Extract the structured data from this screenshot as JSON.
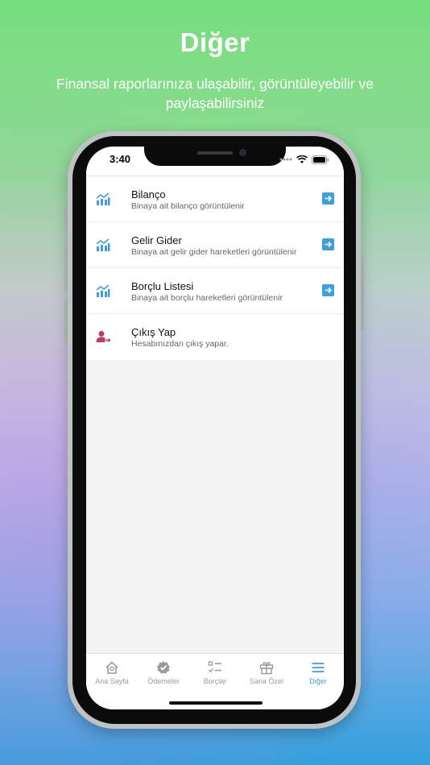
{
  "hero": {
    "title": "Diğer",
    "subtitle": "Finansal raporlarınıza ulaşabilir, görüntüleyebilir ve paylaşabilirsiniz"
  },
  "status_bar": {
    "time": "3:40"
  },
  "menu": {
    "items": [
      {
        "title": "Bilanço",
        "subtitle": "Binaya ait bilanço görüntülenir",
        "icon": "chart-icon"
      },
      {
        "title": "Gelir Gider",
        "subtitle": "Binaya ait gelir gider hareketleri görüntülenir",
        "icon": "chart-icon"
      },
      {
        "title": "Borçlu Listesi",
        "subtitle": "Binaya ait borçlu hareketleri görüntülenir",
        "icon": "chart-icon"
      },
      {
        "title": "Çıkış Yap",
        "subtitle": "Hesabınızdan çıkış yapar.",
        "icon": "logout-user-icon"
      }
    ]
  },
  "tabbar": {
    "tabs": [
      {
        "label": "Ana Sayfa",
        "icon": "home-icon"
      },
      {
        "label": "Ödemeler",
        "icon": "verified-badge-icon"
      },
      {
        "label": "Borçlar",
        "icon": "checklist-icon"
      },
      {
        "label": "Sana Özel",
        "icon": "gift-icon"
      },
      {
        "label": "Diğer",
        "icon": "menu-icon"
      }
    ],
    "active": "Diğer"
  },
  "colors": {
    "accent": "#3d9ee0",
    "logout": "#c23a5c",
    "inactive_tab": "#9a9a9a",
    "bg_top": "#76dd7e",
    "bg_bottom": "#2b9fdc"
  }
}
